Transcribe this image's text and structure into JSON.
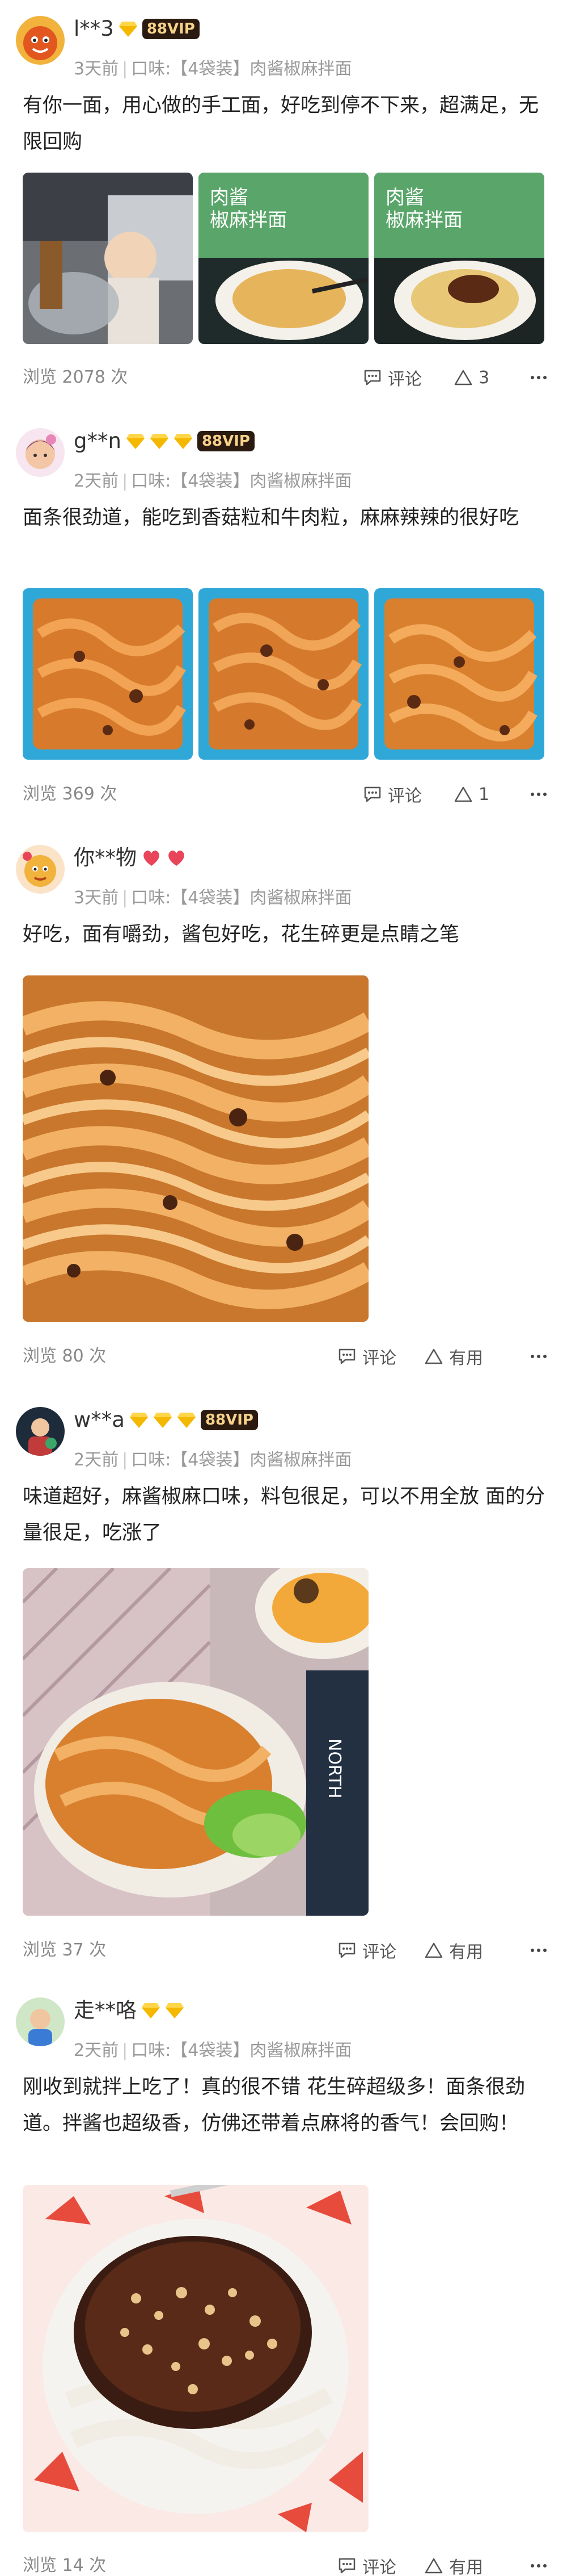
{
  "reviews": [
    {
      "username": "l**3",
      "vip": "88VIP",
      "time": "3天前",
      "flavor": "口味:【4袋装】肉酱椒麻拌面",
      "text": "有你一面，用心做的手工面，好吃到停不下来，超满足，无限回购",
      "views": "浏览 2078 次",
      "comment_label": "评论",
      "like_label": "3"
    },
    {
      "username": "g**n",
      "vip": "88VIP",
      "time": "2天前",
      "flavor": "口味:【4袋装】肉酱椒麻拌面",
      "text": "面条很劲道，能吃到香菇粒和牛肉粒，麻麻辣辣的很好吃",
      "views": "浏览 369 次",
      "comment_label": "评论",
      "like_label": "1"
    },
    {
      "username": "你**物",
      "time": "3天前",
      "flavor": "口味:【4袋装】肉酱椒麻拌面",
      "text": "好吃，面有嚼劲，酱包好吃，花生碎更是点睛之笔",
      "views": "浏览 80 次",
      "comment_label": "评论",
      "like_label": "有用"
    },
    {
      "username": "w**a",
      "vip": "88VIP",
      "time": "2天前",
      "flavor": "口味:【4袋装】肉酱椒麻拌面",
      "text": "味道超好，麻酱椒麻口味，料包很足，可以不用全放 面的分量很足，吃涨了",
      "views": "浏览 37 次",
      "comment_label": "评论",
      "like_label": "有用"
    },
    {
      "username": "走**咯",
      "time": "2天前",
      "flavor": "口味:【4袋装】肉酱椒麻拌面",
      "text": "刚收到就拌上吃了！真的很不错 花生碎超级多！面条很劲道。拌酱也超级香，仿佛还带着点麻将的香气！会回购！",
      "views": "浏览 14 次",
      "comment_label": "评论",
      "like_label": "有用"
    }
  ],
  "photo_text": {
    "package_line1": "肉酱",
    "package_line2": "椒麻拌面",
    "bag_text": "NORTH"
  },
  "colors": {
    "gold_gem": "#f5b800",
    "vip_bg": "#2a1a10",
    "heart": "#e8445a"
  },
  "icons": [
    "comment-icon",
    "like-icon",
    "more-icon",
    "gem-icon",
    "heart-icon"
  ]
}
